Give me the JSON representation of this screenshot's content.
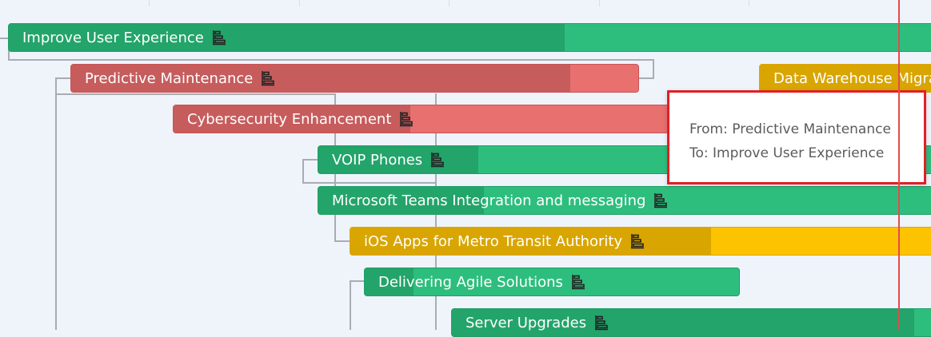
{
  "tasks": [
    {
      "name": "Improve User Experience",
      "status": "green",
      "progress": 0.6
    },
    {
      "name": "Predictive Maintenance",
      "status": "red",
      "progress": 0.88
    },
    {
      "name": "Data Warehouse Migra",
      "status": "yellow",
      "progress": 1.0
    },
    {
      "name": "Cybersecurity Enhancement",
      "status": "red",
      "progress": 0.45
    },
    {
      "name": "VOIP Phones",
      "status": "green",
      "progress": 0.26
    },
    {
      "name": "Microsoft Teams Integration and messaging",
      "status": "green",
      "progress": 0.27
    },
    {
      "name": "iOS Apps for Metro Transit Authority",
      "status": "yellow",
      "progress": 0.62
    },
    {
      "name": "Delivering Agile Solutions",
      "status": "green",
      "progress": 0.13
    },
    {
      "name": "Server Upgrades",
      "status": "green",
      "progress": 0.95
    }
  ],
  "tooltip": {
    "from": "From: Predictive Maintenance",
    "to": "To: Improve User Experience"
  },
  "icon_name": "gantt-icon",
  "colors": {
    "green": "#2dbe7e",
    "green_progress": "#23a46a",
    "red": "#e8706f",
    "red_progress": "#c75c5c",
    "yellow": "#fdc200",
    "yellow_progress": "#d9a500",
    "today_line": "#e8494a",
    "tooltip_border": "#e11f26"
  }
}
